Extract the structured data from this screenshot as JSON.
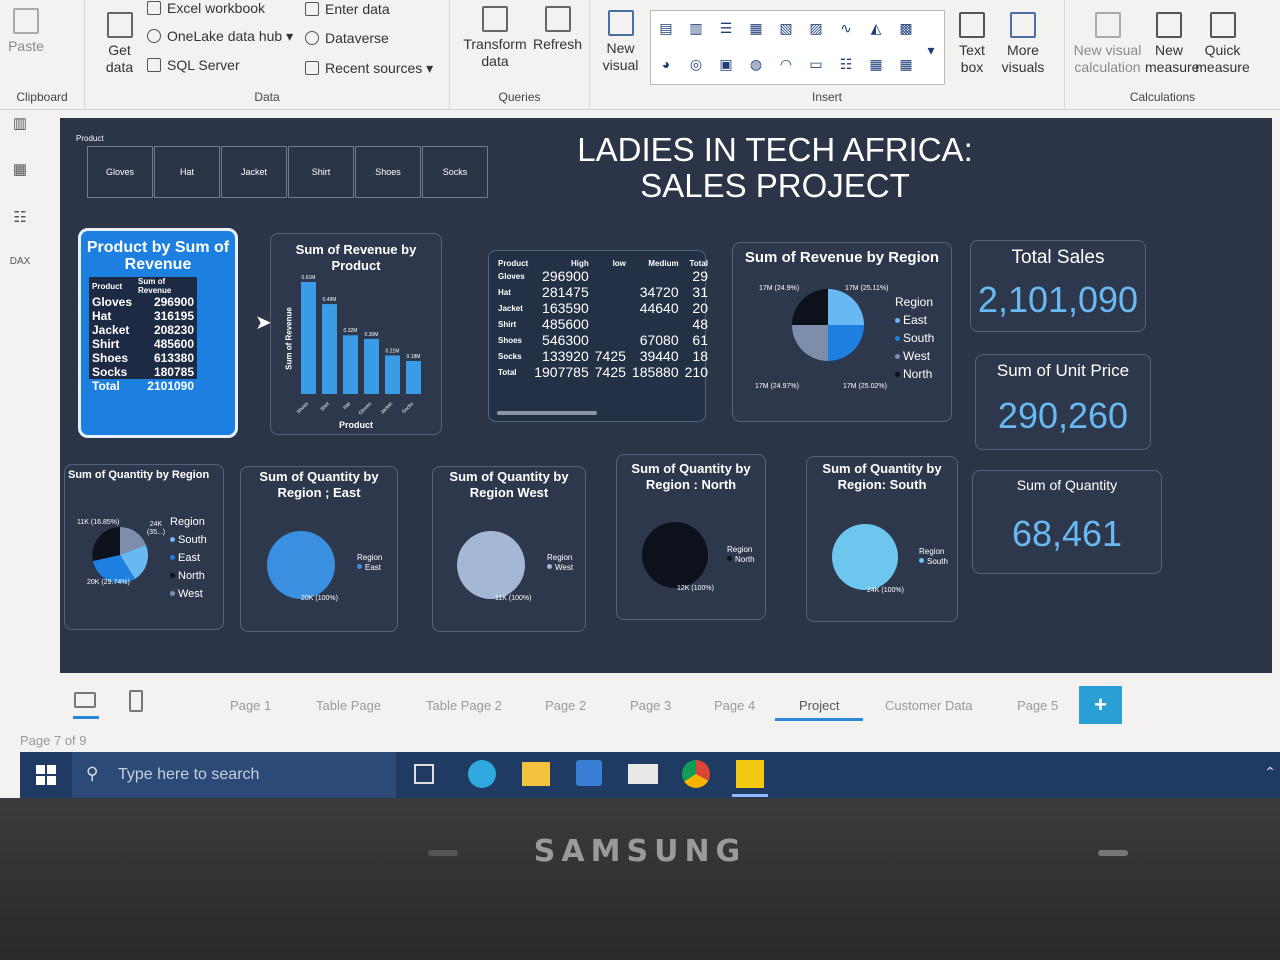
{
  "ribbon": {
    "clipboard": {
      "paste": "Paste",
      "group": "Clipboard"
    },
    "data": {
      "get_data": "Get data",
      "excel": "Excel workbook",
      "onelake": "OneLake data hub",
      "sql": "SQL Server",
      "enter_data": "Enter data",
      "dataverse": "Dataverse",
      "recent": "Recent sources",
      "group": "Data"
    },
    "queries": {
      "transform": "Transform data",
      "refresh": "Refresh",
      "group": "Queries"
    },
    "insert": {
      "new_visual": "New visual",
      "text_box": "Text box",
      "more_visuals": "More visuals",
      "group": "Insert"
    },
    "calculations": {
      "new_visual_calc": "New visual calculation",
      "new_measure": "New measure",
      "quick_measure": "Quick measure",
      "group": "Calculations"
    }
  },
  "report": {
    "title_line1": "LADIES IN TECH AFRICA:",
    "title_line2": "SALES PROJECT",
    "slicer_label": "Product",
    "slicer_items": [
      "Gloves",
      "Hat",
      "Jacket",
      "Shirt",
      "Shoes",
      "Socks"
    ],
    "product_table": {
      "title": "Product by Sum of Revenue",
      "headers": [
        "Product",
        "Sum of Revenue"
      ],
      "rows": [
        [
          "Gloves",
          "296900"
        ],
        [
          "Hat",
          "316195"
        ],
        [
          "Jacket",
          "208230"
        ],
        [
          "Shirt",
          "485600"
        ],
        [
          "Shoes",
          "613380"
        ],
        [
          "Socks",
          "180785"
        ]
      ],
      "total": [
        "Total",
        "2101090"
      ]
    },
    "bar_chart": {
      "title": "Sum of Revenue by Product",
      "ylabel": "Sum of Revenue",
      "xlabel": "Product",
      "labels": [
        "0.61M",
        "0.49M",
        "0.32M",
        "0.30M",
        "0.21M",
        "0.18M"
      ]
    },
    "matrix": {
      "headers": [
        "Product",
        "High",
        "low",
        "Medium",
        "Total"
      ],
      "rows": [
        [
          "Gloves",
          "296900",
          "",
          "",
          "29"
        ],
        [
          "Hat",
          "281475",
          "",
          "34720",
          "31"
        ],
        [
          "Jacket",
          "163590",
          "",
          "44640",
          "20"
        ],
        [
          "Shirt",
          "485600",
          "",
          "",
          "48"
        ],
        [
          "Shoes",
          "546300",
          "",
          "67080",
          "61"
        ],
        [
          "Socks",
          "133920",
          "7425",
          "39440",
          "18"
        ],
        [
          "Total",
          "1907785",
          "7425",
          "185880",
          "210"
        ]
      ]
    },
    "pie_revenue_region": {
      "title": "Sum of Revenue by Region",
      "legend_title": "Region",
      "legend": [
        "East",
        "South",
        "West",
        "North"
      ],
      "labels": [
        "17M (24.9%)",
        "17M (25.11%)",
        "17M (24.97%)",
        "17M (25.02%)"
      ]
    },
    "kpi_total_sales": {
      "title": "Total Sales",
      "value": "2,101,090"
    },
    "kpi_unit_price": {
      "title": "Sum of Unit Price",
      "value": "290,260"
    },
    "kpi_quantity": {
      "title": "Sum of Quantity",
      "value": "68,461"
    },
    "qty_region": {
      "title": "Sum of Quantity by Region",
      "legend_title": "Region",
      "legend": [
        "South",
        "East",
        "North",
        "West"
      ],
      "labels": [
        "11K (16.85%)",
        "24K (35...)",
        "20K (29.74%)"
      ]
    },
    "qty_east": {
      "title": "Sum of Quantity by Region ; East",
      "legend_title": "Region",
      "legend_item": "East",
      "label": "20K (100%)"
    },
    "qty_west": {
      "title": "Sum of Quantity by Region West",
      "legend_title": "Region",
      "legend_item": "West",
      "label": "11K (100%)"
    },
    "qty_north": {
      "title": "Sum of Quantity by Region : North",
      "legend_title": "Region",
      "legend_item": "North",
      "label": "12K (100%)"
    },
    "qty_south": {
      "title": "Sum of Quantity by Region: South",
      "legend_title": "Region",
      "legend_item": "South",
      "label": "24K (100%)"
    }
  },
  "pages": {
    "tabs": [
      "Page 1",
      "Table Page",
      "Table Page 2",
      "Page 2",
      "Page 3",
      "Page 4",
      "Project",
      "Customer Data",
      "Page 5"
    ],
    "active": "Project",
    "status": "Page 7 of 9"
  },
  "taskbar": {
    "search_placeholder": "Type here to search"
  },
  "bezel": {
    "brand": "SAMSUNG"
  },
  "chart_data": {
    "type": "bar",
    "categories": [
      "Shoes",
      "Shirt",
      "Hat",
      "Gloves",
      "Jacket",
      "Socks"
    ],
    "values": [
      0.61,
      0.49,
      0.32,
      0.3,
      0.21,
      0.18
    ],
    "title": "Sum of Revenue by Product",
    "xlabel": "Product",
    "ylabel": "Sum of Revenue"
  },
  "colors": {
    "canvas": "#2b3547",
    "accent_blue": "#3a9be6",
    "light_blue": "#69b8f2",
    "dark": "#101522"
  }
}
